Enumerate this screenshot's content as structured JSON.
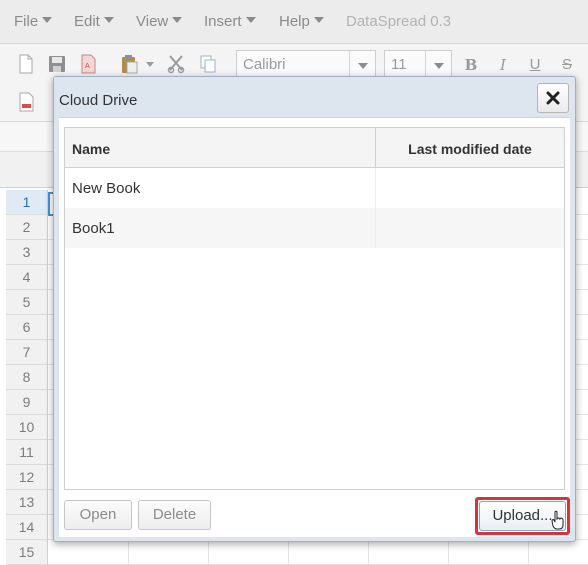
{
  "menubar": {
    "items": [
      {
        "label": "File"
      },
      {
        "label": "Edit"
      },
      {
        "label": "View"
      },
      {
        "label": "Insert"
      },
      {
        "label": "Help"
      }
    ],
    "app_title": "DataSpread 0.3"
  },
  "toolbar": {
    "font_name": "Calibri",
    "font_size": "11",
    "format_buttons": [
      "B",
      "I",
      "U",
      "S"
    ]
  },
  "sheet": {
    "row_numbers": [
      "1",
      "2",
      "3",
      "4",
      "5",
      "6",
      "7",
      "8",
      "9",
      "10",
      "11",
      "12",
      "13",
      "14",
      "15"
    ],
    "active_row": "1",
    "colors": {
      "active_row_bg": "#dfeaf5",
      "selection_border": "#4b8fd0"
    }
  },
  "dialog": {
    "title": "Cloud Drive",
    "close_icon": "close-icon",
    "columns": {
      "name": "Name",
      "modified": "Last modified date"
    },
    "files": [
      {
        "name": "New Book",
        "modified": ""
      },
      {
        "name": "Book1",
        "modified": ""
      }
    ],
    "buttons": {
      "open": "Open",
      "delete": "Delete",
      "upload": "Upload..."
    },
    "highlight_color": "#d4343c"
  }
}
